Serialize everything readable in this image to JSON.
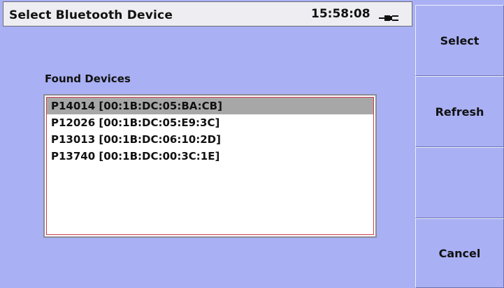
{
  "header": {
    "title": "Select Bluetooth Device",
    "clock": "15:58:08",
    "power_icon": "plug-icon"
  },
  "main": {
    "found_label": "Found Devices",
    "devices": [
      "P14014 [00:1B:DC:05:BA:CB]",
      "P12026 [00:1B:DC:05:E9:3C]",
      "P13013 [00:1B:DC:06:10:2D]",
      "P13740 [00:1B:DC:00:3C:1E]"
    ],
    "selected_index": 0
  },
  "softkeys": [
    {
      "label": "Select"
    },
    {
      "label": "Refresh"
    },
    {
      "label": ""
    },
    {
      "label": "Cancel"
    }
  ],
  "colors": {
    "background": "#a9b0f3",
    "title_bar": "#eeeef2",
    "selection": "#a7a7a7",
    "list_focus_border": "#cc3d4d"
  }
}
